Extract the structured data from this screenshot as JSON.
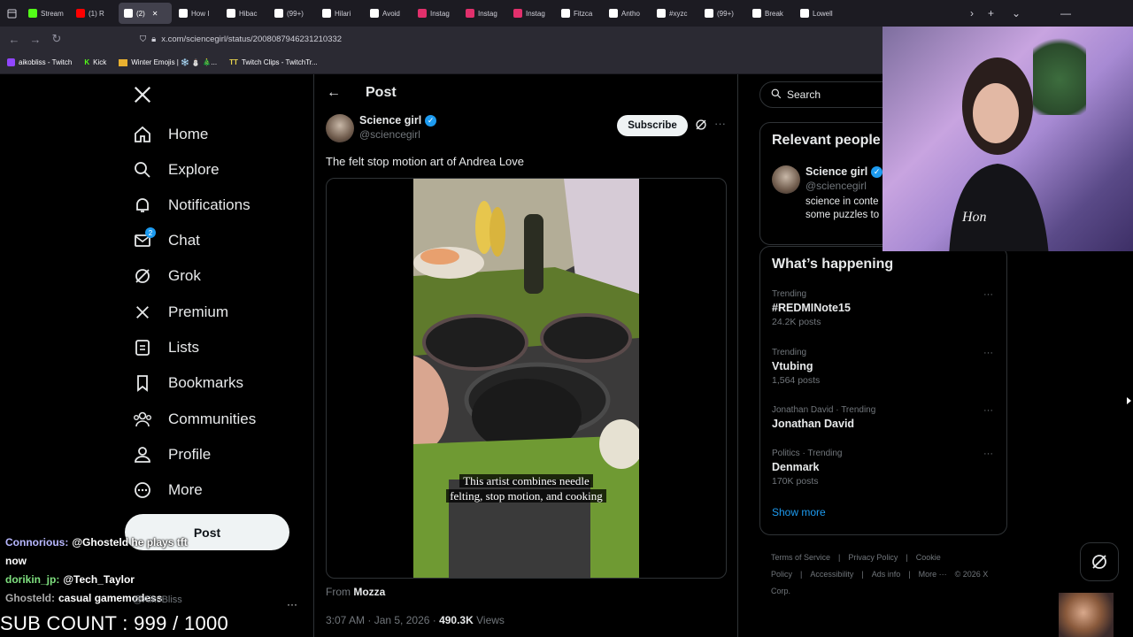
{
  "browser": {
    "tabs": [
      {
        "label": "Stream",
        "color": "#53fc18"
      },
      {
        "label": "(1) R",
        "color": "#ff0000"
      },
      {
        "label": "(2)",
        "color": "#ffffff",
        "active": true
      },
      {
        "label": "How I",
        "color": "#ffffff"
      },
      {
        "label": "Hibac",
        "color": "#ffffff"
      },
      {
        "label": "(99+)",
        "color": "#ffffff"
      },
      {
        "label": "Hilari",
        "color": "#ffffff"
      },
      {
        "label": "Avoid",
        "color": "#ffffff"
      },
      {
        "label": "Instag",
        "color": "#e1306c"
      },
      {
        "label": "Instag",
        "color": "#e1306c"
      },
      {
        "label": "Instag",
        "color": "#e1306c"
      },
      {
        "label": "Fitzca",
        "color": "#ffffff"
      },
      {
        "label": "Antho",
        "color": "#ffffff"
      },
      {
        "label": "#xyzc",
        "color": "#ffffff"
      },
      {
        "label": "(99+)",
        "color": "#ffffff"
      },
      {
        "label": "Break",
        "color": "#ffffff"
      },
      {
        "label": "Lowell",
        "color": "#ffffff"
      }
    ],
    "url": "x.com/sciencegirl/status/2008087946231210332",
    "bookmarks": [
      {
        "label": "aikobliss - Twitch"
      },
      {
        "label": "Kick"
      },
      {
        "label": "Winter Emojis | ❄️ ⛄ 🎄..."
      },
      {
        "label": "Twitch Clips - TwitchTr..."
      }
    ]
  },
  "nav": {
    "items": [
      {
        "label": "Home",
        "icon": "home-icon"
      },
      {
        "label": "Explore",
        "icon": "search-icon"
      },
      {
        "label": "Notifications",
        "icon": "bell-icon"
      },
      {
        "label": "Chat",
        "icon": "mail-icon",
        "badge": "2"
      },
      {
        "label": "Grok",
        "icon": "grok-icon"
      },
      {
        "label": "Premium",
        "icon": "x-logo-icon"
      },
      {
        "label": "Lists",
        "icon": "list-icon"
      },
      {
        "label": "Bookmarks",
        "icon": "bookmark-icon"
      },
      {
        "label": "Communities",
        "icon": "people-icon"
      },
      {
        "label": "Profile",
        "icon": "person-icon"
      },
      {
        "label": "More",
        "icon": "more-circle-icon"
      }
    ],
    "post_label": "Post",
    "account_handle": "@AikoBliss"
  },
  "post": {
    "header": "Post",
    "author_name": "Science girl",
    "author_handle": "@sciencegirl",
    "subscribe": "Subscribe",
    "text": "The felt stop motion art of Andrea Love",
    "caption_line1": "This artist combines needle",
    "caption_line2": "felting, stop motion, and cooking",
    "from_prefix": "From",
    "from_name": "Mozza",
    "time": "3:07 AM · Jan 5, 2026 · ",
    "views_count": "490.3K",
    "views_label": " Views"
  },
  "sidebar": {
    "search_placeholder": "Search",
    "relevant_title": "Relevant people",
    "relevant_name": "Science girl",
    "relevant_handle": "@sciencegirl",
    "relevant_bio1": "science in conte",
    "relevant_bio2": "some puzzles to",
    "happening_title": "What’s happening",
    "trends": [
      {
        "meta": "Trending",
        "name": "#REDMINote15",
        "count": "24.2K posts"
      },
      {
        "meta": "Trending",
        "name": "Vtubing",
        "count": "1,564 posts"
      },
      {
        "meta": "Jonathan David · Trending",
        "name": "Jonathan David",
        "count": ""
      },
      {
        "meta": "Politics · Trending",
        "name": "Denmark",
        "count": "170K posts"
      }
    ],
    "show_more": "Show more",
    "footer": [
      "Terms of Service",
      "|",
      "Privacy Policy",
      "|",
      "Cookie Policy",
      "|",
      "Accessibility",
      "|",
      "Ads info",
      "|",
      "More ···",
      "© 2026 X Corp."
    ]
  },
  "overlay": {
    "chat": [
      {
        "user": "Connorious:",
        "msg": "@Ghosteld he plays tft"
      },
      {
        "user": "",
        "msg": "now"
      },
      {
        "user": "dorikin_jp:",
        "msg": "@Tech_Taylor"
      },
      {
        "user": "Ghosteld:",
        "msg": "casual gamemodess"
      }
    ],
    "sub_count": "SUB COUNT : 999 / 1000"
  },
  "colors": {
    "accent": "#1d9bf0",
    "background": "#000000",
    "border": "#2f3336"
  }
}
